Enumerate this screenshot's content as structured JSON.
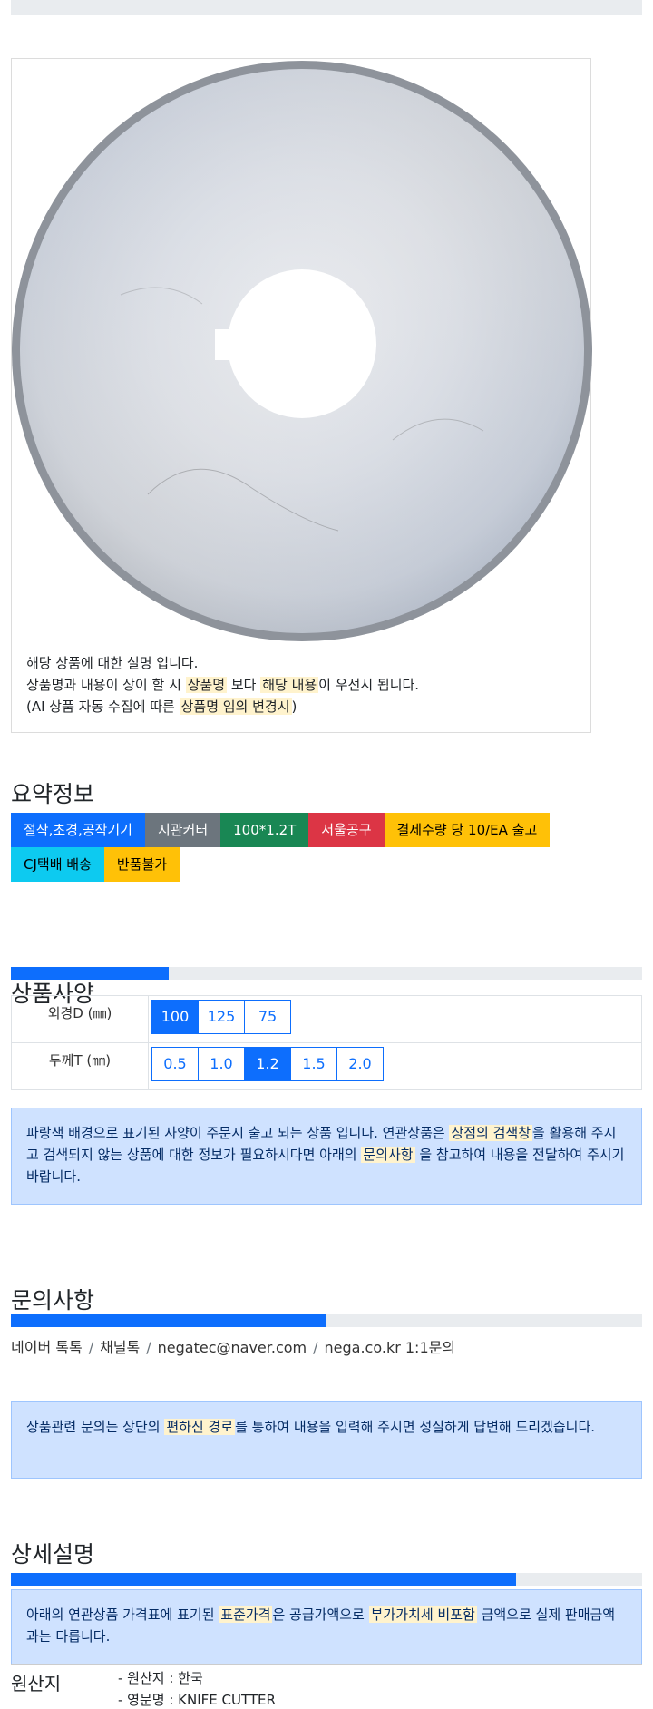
{
  "product_image": {
    "caption_line1": "해당 상품에 대한 설명 입니다.",
    "caption_line2_a": "상품명과 내용이 상이 할 시 ",
    "caption_line2_hl1": "상품명",
    "caption_line2_b": " 보다 ",
    "caption_line2_hl2": "해당 내용",
    "caption_line2_c": "이 우선시 됩니다.",
    "caption_line3_a": "(AI 상품 자동 수집에 따른 ",
    "caption_line3_hl": "상품명 임의 변경시",
    "caption_line3_b": ")"
  },
  "summary": {
    "title": "요약정보",
    "badges": [
      {
        "label": "절삭,초경,공작기기",
        "color": "#0d6efd",
        "text_color": "#ffffff"
      },
      {
        "label": "지관커터",
        "color": "#6c757d",
        "text_color": "#ffffff"
      },
      {
        "label": "100*1.2T",
        "color": "#198754",
        "text_color": "#ffffff"
      },
      {
        "label": "서울공구",
        "color": "#dc3545",
        "text_color": "#ffffff"
      },
      {
        "label": "결제수량 당 10/EA 출고",
        "color": "#ffc107",
        "text_color": "#000000"
      },
      {
        "label": "CJ택배 배송",
        "color": "#0dcaf0",
        "text_color": "#000000"
      },
      {
        "label": "반품불가",
        "color": "#ffc107",
        "text_color": "#000000"
      }
    ]
  },
  "specs": {
    "progress": 0.25,
    "title": "상품사양",
    "outer_label": "외경D (㎜)",
    "outer_options": [
      "100",
      "125",
      "75"
    ],
    "outer_selected": "100",
    "thickness_label": "두께T (㎜)",
    "thickness_options": [
      "0.5",
      "1.0",
      "1.2",
      "1.5",
      "2.0"
    ],
    "thickness_selected": "1.2",
    "notice_a": "파랑색 배경으로 표기된 사양이 주문시 출고 되는 상품 입니다. 연관상품은 ",
    "notice_hl1": "상점의 검색창",
    "notice_b": "을 활용해 주시고 검색되지 않는 상품에 대한 정보가 필요하시다면 아래의 ",
    "notice_hl2": "문의사항",
    "notice_c": " 을 참고하여 내용을 전달하여 주시기 바랍니다."
  },
  "inquiry": {
    "title": "문의사항",
    "progress": 0.5,
    "contacts": [
      "네이버 톡톡",
      "채널톡",
      "negatec@naver.com",
      "nega.co.kr 1:1문의"
    ],
    "separator": "/",
    "notice_a": "상품관련 문의는 상단의 ",
    "notice_hl": "편하신 경로",
    "notice_b": "를 통하여 내용을 입력해 주시면 성실하게 답변해 드리겠습니다."
  },
  "detail": {
    "title": "상세설명",
    "progress": 0.8,
    "notice_a": "아래의 연관상품 가격표에 표기된 ",
    "notice_hl1": "표준가격",
    "notice_b": "은 공급가액으로 ",
    "notice_hl2": "부가가치세 비포함",
    "notice_c": " 금액으로 실제 판매금액과는 다릅니다."
  },
  "origin": {
    "label": "원산지",
    "items": [
      "- 원산지 : 한국",
      "- 영문명 : KNIFE CUTTER"
    ]
  }
}
